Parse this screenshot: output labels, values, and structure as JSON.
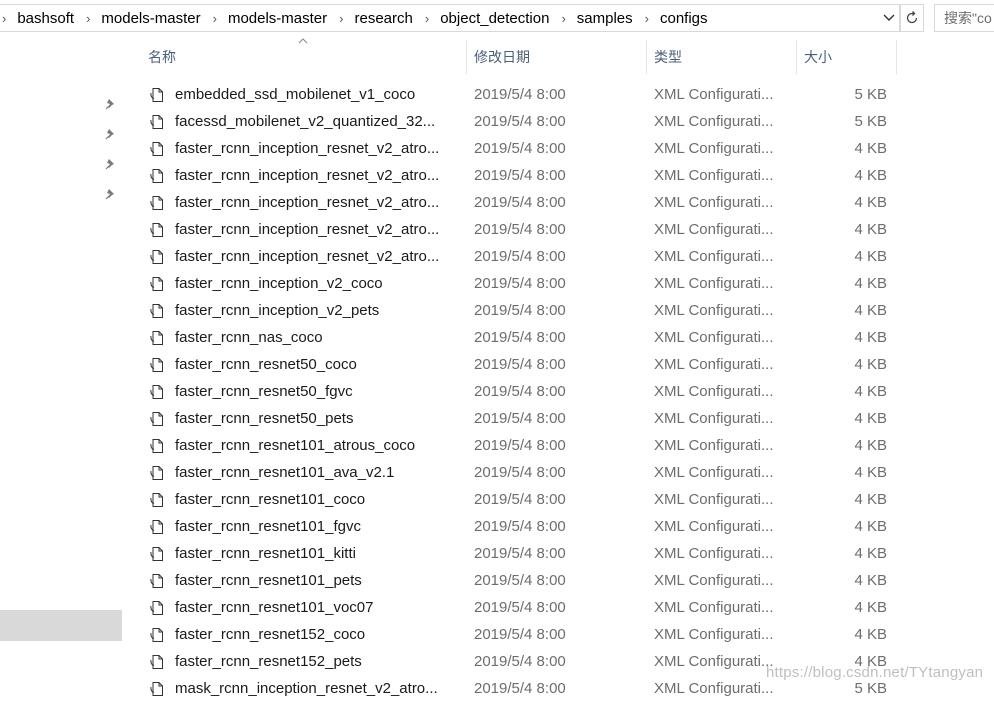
{
  "address_bar": {
    "crumbs": [
      "bashsoft",
      "models-master",
      "models-master",
      "research",
      "object_detection",
      "samples",
      "configs"
    ]
  },
  "search": {
    "placeholder": "搜索\"co"
  },
  "columns": {
    "name": "名称",
    "date": "修改日期",
    "type": "类型",
    "size": "大小"
  },
  "files": [
    {
      "name": "embedded_ssd_mobilenet_v1_coco",
      "date": "2019/5/4 8:00",
      "type": "XML Configurati...",
      "size": "5 KB"
    },
    {
      "name": "facessd_mobilenet_v2_quantized_32...",
      "date": "2019/5/4 8:00",
      "type": "XML Configurati...",
      "size": "5 KB"
    },
    {
      "name": "faster_rcnn_inception_resnet_v2_atro...",
      "date": "2019/5/4 8:00",
      "type": "XML Configurati...",
      "size": "4 KB"
    },
    {
      "name": "faster_rcnn_inception_resnet_v2_atro...",
      "date": "2019/5/4 8:00",
      "type": "XML Configurati...",
      "size": "4 KB"
    },
    {
      "name": "faster_rcnn_inception_resnet_v2_atro...",
      "date": "2019/5/4 8:00",
      "type": "XML Configurati...",
      "size": "4 KB"
    },
    {
      "name": "faster_rcnn_inception_resnet_v2_atro...",
      "date": "2019/5/4 8:00",
      "type": "XML Configurati...",
      "size": "4 KB"
    },
    {
      "name": "faster_rcnn_inception_resnet_v2_atro...",
      "date": "2019/5/4 8:00",
      "type": "XML Configurati...",
      "size": "4 KB"
    },
    {
      "name": "faster_rcnn_inception_v2_coco",
      "date": "2019/5/4 8:00",
      "type": "XML Configurati...",
      "size": "4 KB"
    },
    {
      "name": "faster_rcnn_inception_v2_pets",
      "date": "2019/5/4 8:00",
      "type": "XML Configurati...",
      "size": "4 KB"
    },
    {
      "name": "faster_rcnn_nas_coco",
      "date": "2019/5/4 8:00",
      "type": "XML Configurati...",
      "size": "4 KB"
    },
    {
      "name": "faster_rcnn_resnet50_coco",
      "date": "2019/5/4 8:00",
      "type": "XML Configurati...",
      "size": "4 KB"
    },
    {
      "name": "faster_rcnn_resnet50_fgvc",
      "date": "2019/5/4 8:00",
      "type": "XML Configurati...",
      "size": "4 KB"
    },
    {
      "name": "faster_rcnn_resnet50_pets",
      "date": "2019/5/4 8:00",
      "type": "XML Configurati...",
      "size": "4 KB"
    },
    {
      "name": "faster_rcnn_resnet101_atrous_coco",
      "date": "2019/5/4 8:00",
      "type": "XML Configurati...",
      "size": "4 KB"
    },
    {
      "name": "faster_rcnn_resnet101_ava_v2.1",
      "date": "2019/5/4 8:00",
      "type": "XML Configurati...",
      "size": "4 KB"
    },
    {
      "name": "faster_rcnn_resnet101_coco",
      "date": "2019/5/4 8:00",
      "type": "XML Configurati...",
      "size": "4 KB"
    },
    {
      "name": "faster_rcnn_resnet101_fgvc",
      "date": "2019/5/4 8:00",
      "type": "XML Configurati...",
      "size": "4 KB"
    },
    {
      "name": "faster_rcnn_resnet101_kitti",
      "date": "2019/5/4 8:00",
      "type": "XML Configurati...",
      "size": "4 KB"
    },
    {
      "name": "faster_rcnn_resnet101_pets",
      "date": "2019/5/4 8:00",
      "type": "XML Configurati...",
      "size": "4 KB"
    },
    {
      "name": "faster_rcnn_resnet101_voc07",
      "date": "2019/5/4 8:00",
      "type": "XML Configurati...",
      "size": "4 KB"
    },
    {
      "name": "faster_rcnn_resnet152_coco",
      "date": "2019/5/4 8:00",
      "type": "XML Configurati...",
      "size": "4 KB"
    },
    {
      "name": "faster_rcnn_resnet152_pets",
      "date": "2019/5/4 8:00",
      "type": "XML Configurati...",
      "size": "4 KB"
    },
    {
      "name": "mask_rcnn_inception_resnet_v2_atro...",
      "date": "2019/5/4 8:00",
      "type": "XML Configurati...",
      "size": "5 KB"
    }
  ],
  "watermark": "https://blog.csdn.net/TYtangyan",
  "icons": {
    "file": "document-icon",
    "pin": "pin-icon",
    "refresh": "refresh-icon",
    "dropdown": "chevron-down-icon",
    "separator": "chevron-right-icon"
  }
}
